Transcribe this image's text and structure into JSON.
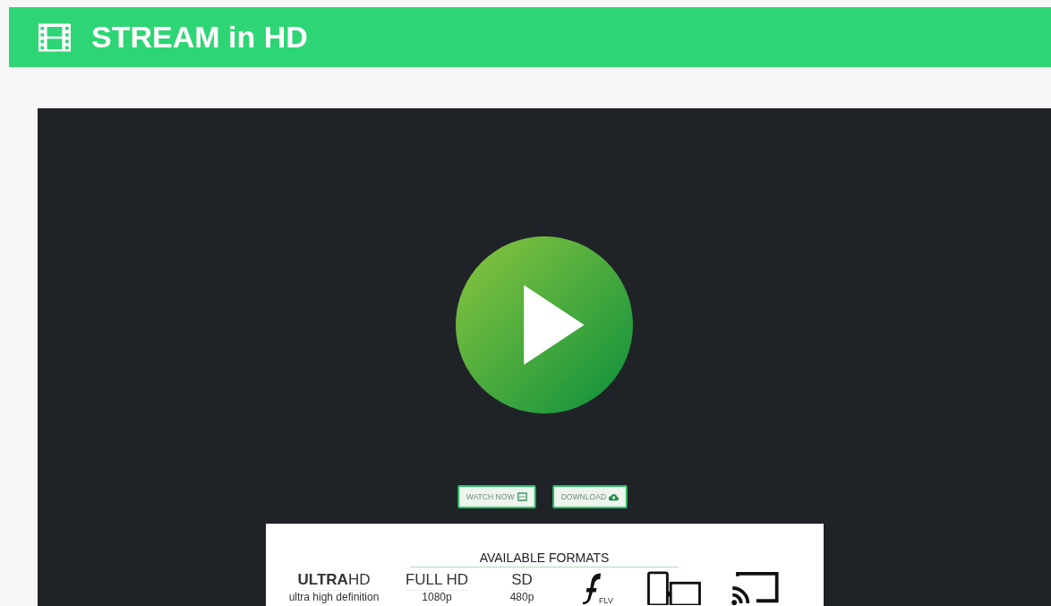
{
  "header": {
    "title": "STREAM in HD"
  },
  "player": {
    "buttons": [
      {
        "label": "WATCH NOW",
        "kind": "watch"
      },
      {
        "label": "DOWNLOAD",
        "kind": "download"
      }
    ]
  },
  "formats": {
    "title": "AVAILABLE FORMATS",
    "items": [
      {
        "kind": "text",
        "name": "**ULTRA**HD",
        "detail": "ultra high definition"
      },
      {
        "kind": "text",
        "name": "FULL HD",
        "detail": "1080p"
      },
      {
        "kind": "text",
        "name": "SD",
        "detail": "480p"
      },
      {
        "kind": "flash",
        "name": "FLV"
      },
      {
        "kind": "devices"
      },
      {
        "kind": "cast"
      }
    ]
  }
}
